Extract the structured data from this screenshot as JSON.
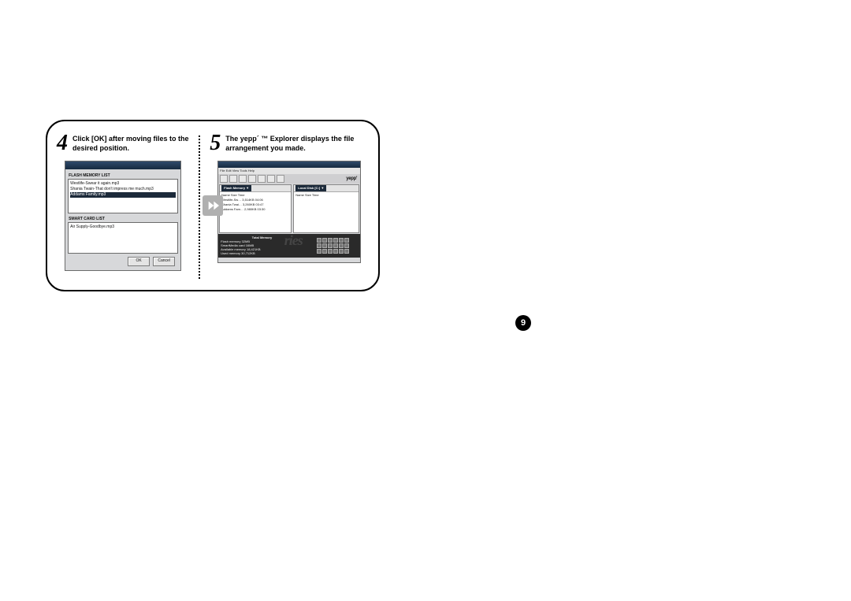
{
  "steps": {
    "four": {
      "num": "4",
      "text": "Click [OK] after moving files to the desired position."
    },
    "five": {
      "num": "5",
      "text": "The yepp´ ™ Explorer displays the file arrangement you made."
    }
  },
  "dialog": {
    "flash_label": "FLASH MEMORY LIST",
    "flash_items": [
      "Westlife-Swear it again.mp3",
      "Shania Twain-That don't impress me much.mp3",
      "Addams Family.mp3"
    ],
    "card_label": "SMART CARD LIST",
    "card_items": [
      "Air Supply-Goodbye.mp3"
    ],
    "ok": "OK",
    "cancel": "Cancel"
  },
  "explorer": {
    "menu": "File   Edit   View   Tools   Help",
    "logo": "yepp'",
    "left_header": "Flash Memory    ▼",
    "right_header": "Local Disk [C:]    ▼",
    "cols": "Name          Size     Time",
    "rows": [
      "Westlife-Sw…   3,514KB   04:06",
      "Shania Twai…   3,260KB   03:47",
      "Addams Fam…   2,980KB   03:30"
    ],
    "status": {
      "title": "Total Memory",
      "lines": [
        "Flash memory        32MB",
        "SmartMedia card     16MB",
        "Available memory    18,421KB",
        "Used memory         30,712KB"
      ]
    },
    "watermark": "ries"
  },
  "page_number": "9"
}
